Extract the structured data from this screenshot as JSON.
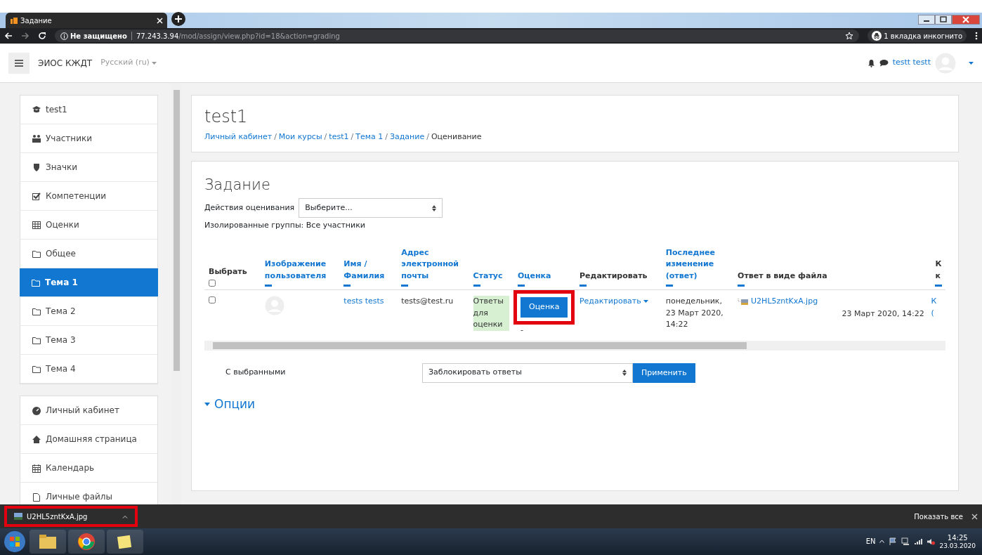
{
  "browser": {
    "tab_title": "Задание",
    "security": "Не защищено",
    "url_host": "77.243.3.94",
    "url_path": "/mod/assign/view.php?id=18&action=grading",
    "incognito": "1 вкладка инкогнито"
  },
  "navbar": {
    "brand": "ЭИОС КЖДТ",
    "language": "Русский (ru)",
    "user": "testt testt"
  },
  "sidebar": {
    "groups": [
      [
        {
          "label": "test1",
          "kind": "course",
          "selected": false
        },
        {
          "label": "Участники",
          "kind": "people",
          "selected": false
        },
        {
          "label": "Значки",
          "kind": "shield",
          "selected": false
        },
        {
          "label": "Компетенции",
          "kind": "check",
          "selected": false
        },
        {
          "label": "Оценки",
          "kind": "table",
          "selected": false
        },
        {
          "label": "Общее",
          "kind": "folder",
          "selected": false
        },
        {
          "label": "Тема 1",
          "kind": "folder",
          "selected": true
        },
        {
          "label": "Тема 2",
          "kind": "folder",
          "selected": false
        },
        {
          "label": "Тема 3",
          "kind": "folder",
          "selected": false
        },
        {
          "label": "Тема 4",
          "kind": "folder",
          "selected": false
        }
      ],
      [
        {
          "label": "Личный кабинет",
          "kind": "dashboard",
          "selected": false
        },
        {
          "label": "Домашняя страница",
          "kind": "home",
          "selected": false
        },
        {
          "label": "Календарь",
          "kind": "calendar",
          "selected": false
        },
        {
          "label": "Личные файлы",
          "kind": "file",
          "selected": false
        }
      ]
    ]
  },
  "page_header": {
    "title": "test1",
    "separator": "/",
    "breadcrumbs": [
      "Личный кабинет",
      "Мои курсы",
      "test1",
      "Тема 1",
      "Задание",
      "Оценивание"
    ]
  },
  "assignment": {
    "title": "Задание",
    "grading_action_label": "Действия оценивания",
    "grading_action_value": "Выберите...",
    "groups_text": "Изолированные группы: Все участники",
    "table": {
      "select_all_checked": false,
      "columns": [
        {
          "label": "Выбрать",
          "kind": "select",
          "sortable": false
        },
        {
          "label": "Изображение пользователя",
          "kind": "text",
          "sortable": true
        },
        {
          "label": "Имя / Фамилия",
          "kind": "text",
          "sortable": true
        },
        {
          "label": "Адрес электронной почты",
          "kind": "text",
          "sortable": true
        },
        {
          "label": "Статус",
          "kind": "text",
          "sortable": true
        },
        {
          "label": "Оценка",
          "kind": "text",
          "sortable": true
        },
        {
          "label": "Редактировать",
          "kind": "text",
          "sortable": false
        },
        {
          "label": "Последнее изменение (ответ)",
          "kind": "text",
          "sortable": true
        },
        {
          "label": "Ответ в виде файла",
          "kind": "text",
          "sortable": false
        },
        {
          "kind": "blank"
        },
        {
          "label": "К к",
          "kind": "text",
          "sortable": false
        }
      ],
      "rows": [
        {
          "checked": false,
          "name": "tests tests",
          "email": "tests@test.ru",
          "status": "Ответы для оценки",
          "grade_button": "Оценка",
          "grade_button_highlighted": true,
          "grade": "-",
          "edit": "Редактировать",
          "modified": "понедельник, 23 Март 2020, 14:22",
          "file": "U2HL5zntKxA.jpg",
          "file_date": "23 Март 2020, 14:22",
          "column_11": "К ("
        }
      ]
    },
    "bulk_label": "С выбранными",
    "bulk_value": "Заблокировать ответы",
    "apply_button": "Применить",
    "options_heading": "Опции"
  },
  "download_bar": {
    "file": "U2HL5zntKxA.jpg",
    "highlighted": true,
    "show_all": "Показать все"
  },
  "taskbar": {
    "language": "EN",
    "time": "14:25",
    "date": "23.03.2020"
  }
}
